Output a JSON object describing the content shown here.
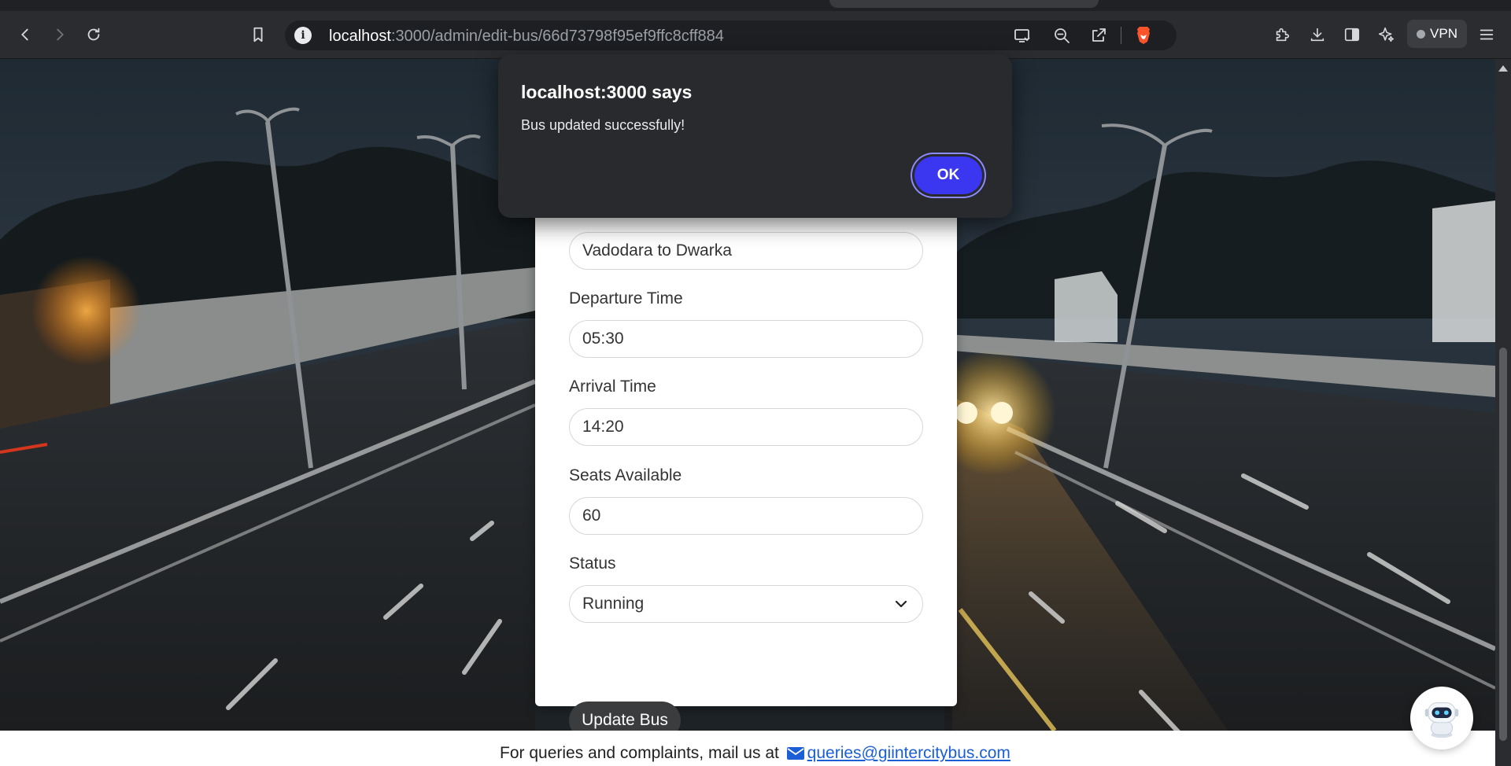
{
  "browser": {
    "url_host": "localhost",
    "url_path": ":3000/admin/edit-bus/66d73798f95ef9ffc8cff884",
    "vpn_label": "VPN"
  },
  "alert": {
    "title": "localhost:3000 says",
    "message": "Bus updated successfully!",
    "ok_label": "OK"
  },
  "form": {
    "route_value": "Vadodara to Dwarka",
    "departure_label": "Departure Time",
    "departure_value": "05:30",
    "arrival_label": "Arrival Time",
    "arrival_value": "14:20",
    "seats_label": "Seats Available",
    "seats_value": "60",
    "status_label": "Status",
    "status_value": "Running",
    "submit_label": "Update Bus"
  },
  "footer": {
    "text": "For queries and complaints, mail us at",
    "email": "queries@giintercitybus.com"
  },
  "colors": {
    "accent_button": "#3b36f0",
    "update_button": "#3b3c3e",
    "link": "#1a5fd6"
  },
  "icons": [
    "back-icon",
    "forward-icon",
    "reload-icon",
    "bookmark-icon",
    "site-info-icon",
    "cast-icon",
    "zoom-icon",
    "share-icon",
    "brave-shield-icon",
    "extensions-icon",
    "download-icon",
    "sidebar-icon",
    "leo-ai-icon",
    "menu-icon",
    "chevron-down-icon",
    "envelope-icon",
    "chatbot-icon"
  ]
}
